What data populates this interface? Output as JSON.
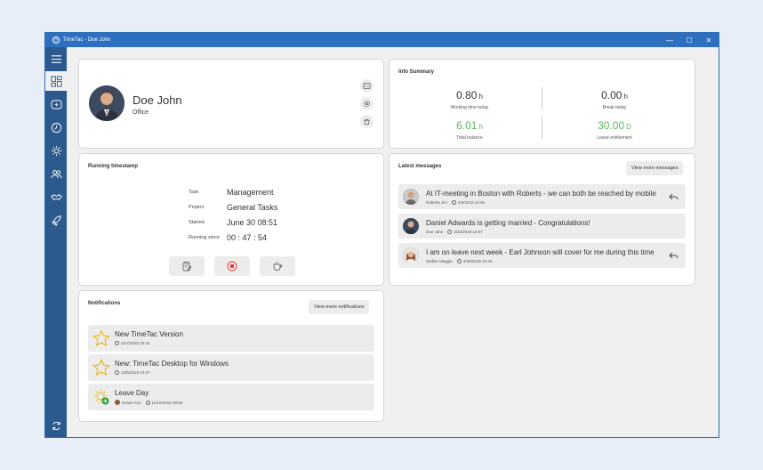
{
  "window": {
    "title": "TimeTac - Doe John",
    "minimize": "—",
    "maximize": "☐",
    "close": "✕"
  },
  "sidebar": {
    "items": [
      {
        "icon": "menu-icon"
      },
      {
        "icon": "dashboard-icon"
      },
      {
        "icon": "time-tracking-icon"
      },
      {
        "icon": "clock-icon"
      },
      {
        "icon": "sun-icon"
      },
      {
        "icon": "users-icon"
      },
      {
        "icon": "handshake-icon"
      },
      {
        "icon": "rocket-icon"
      },
      {
        "icon": "sync-icon"
      }
    ]
  },
  "profile": {
    "name": "Doe John",
    "role": "Office"
  },
  "info_summary": {
    "title": "Info Summary",
    "working_time": {
      "value": "0.80",
      "unit": "h",
      "label": "Working time today"
    },
    "break_today": {
      "value": "0.00",
      "unit": "h",
      "label": "Break today"
    },
    "total_balance": {
      "value": "6.01",
      "unit": "h",
      "label": "Total balance"
    },
    "leave_entitlement": {
      "value": "30.00",
      "unit": "D",
      "label": "Leave entitlement"
    }
  },
  "running_timestamp": {
    "title": "Running timestamp",
    "task_label": "Task",
    "task_value": "Management",
    "project_label": "Project",
    "project_value": "General Tasks",
    "started_label": "Started",
    "started_value": "June 30 08:51",
    "running_label": "Running since",
    "running_value": "00 : 47 : 54"
  },
  "messages": {
    "title": "Latest messages",
    "view_more": "View more messages",
    "items": [
      {
        "text": "At IT-meeting in Boston with Roberts - we can both be reached by mobile",
        "sender": "Roberts Jim",
        "date": "3/4/2019 10:46"
      },
      {
        "text": "Daniel Adwards is getting married - Congratulations!",
        "sender": "Doe John",
        "date": "4/26/2019 10:57"
      },
      {
        "text": "I am on leave next week  - Earl Johnson will cover for me during this time",
        "sender": "Walker Maggie",
        "date": "4/28/2019 10:40"
      }
    ]
  },
  "notifications": {
    "title": "Notifications",
    "view_more": "View more notifications",
    "items": [
      {
        "text": "New TimeTac Version",
        "date": "4/27/2020 23:41"
      },
      {
        "text": "New: TimeTac Desktop for Windows",
        "date": "12/5/2019 10:47"
      },
      {
        "text": "Leave Day",
        "user": "Evans Ann",
        "date": "11/15/2019 09:59"
      }
    ]
  },
  "colors": {
    "titlebar": "#2e6fbf",
    "sidebar": "#2d5a8e",
    "positive": "#5cb85c",
    "star": "#f0b400",
    "stop": "#e53935"
  }
}
